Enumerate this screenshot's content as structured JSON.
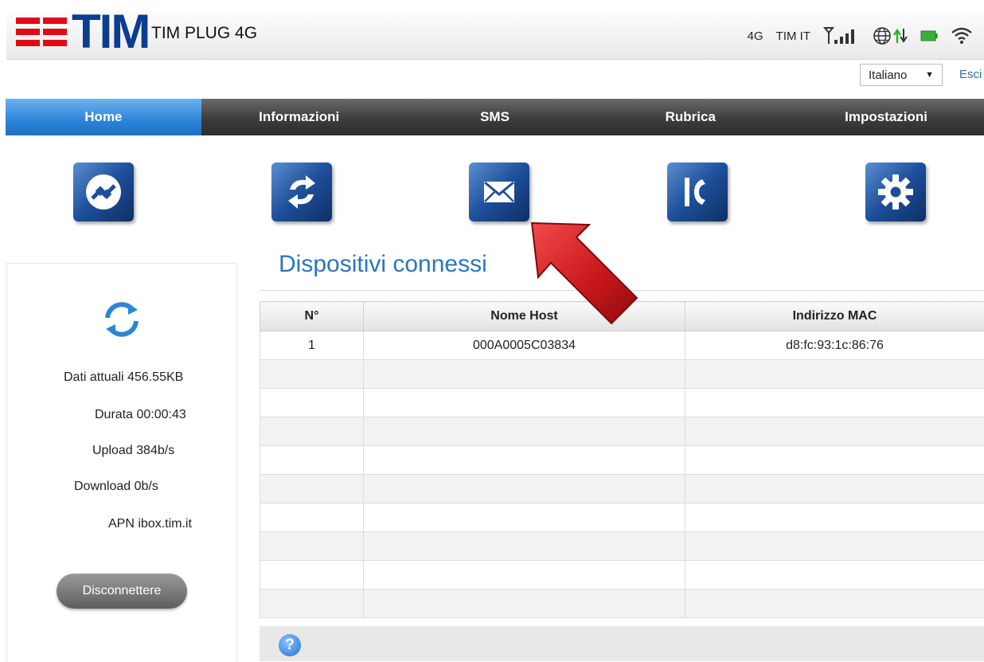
{
  "header": {
    "logo": "TIM",
    "product": "TIM PLUG 4G",
    "network_type": "4G",
    "carrier": "TIM IT",
    "icons": [
      "signal-icon",
      "globe-icon",
      "data-transfer-icon",
      "battery-icon",
      "wifi-icon"
    ]
  },
  "language": {
    "selected": "Italiano"
  },
  "logout_label": "Esci",
  "nav": {
    "items": [
      {
        "label": "Home",
        "active": true
      },
      {
        "label": "Informazioni",
        "active": false
      },
      {
        "label": "SMS",
        "active": false
      },
      {
        "label": "Rubrica",
        "active": false
      },
      {
        "label": "Impostazioni",
        "active": false
      }
    ]
  },
  "shortcut_icons": [
    "connection-icon",
    "sync-icon",
    "mail-icon",
    "phone-icon",
    "settings-icon"
  ],
  "stats": {
    "data": "Dati attuali 456.55KB",
    "duration": "Durata 00:00:43",
    "upload": "Upload 384b/s",
    "download": "Download 0b/s",
    "apn": "APN ibox.tim.it"
  },
  "disconnect_label": "Disconnettere",
  "devices": {
    "title": "Dispositivi connessi",
    "columns": [
      "N°",
      "Nome Host",
      "Indirizzo MAC"
    ],
    "rows": [
      [
        "1",
        "000A0005C03834",
        "d8:fc:93:1c:86:76"
      ],
      [
        "",
        "",
        ""
      ],
      [
        "",
        "",
        ""
      ],
      [
        "",
        "",
        ""
      ],
      [
        "",
        "",
        ""
      ],
      [
        "",
        "",
        ""
      ],
      [
        "",
        "",
        ""
      ],
      [
        "",
        "",
        ""
      ],
      [
        "",
        "",
        ""
      ],
      [
        "",
        "",
        ""
      ]
    ]
  },
  "help_symbol": "?",
  "colors": {
    "brand_red": "#e10a17",
    "brand_blue": "#0b3d91",
    "accent_blue": "#2d84d8"
  }
}
